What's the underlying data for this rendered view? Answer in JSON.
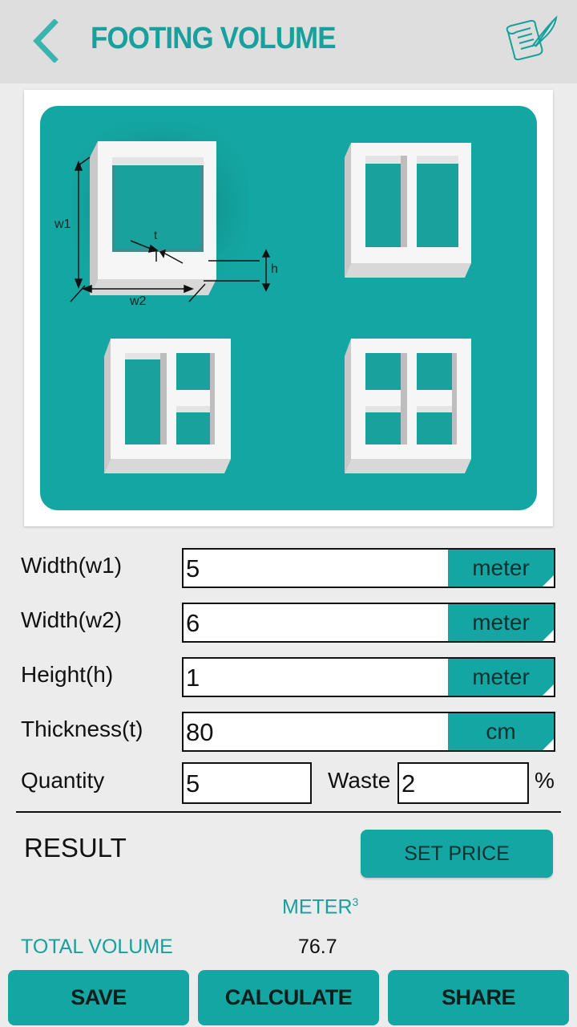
{
  "header": {
    "title": "FOOTING VOLUME",
    "back_icon": "chevron-left-icon",
    "notes_icon": "scroll-quill-icon"
  },
  "diagram": {
    "labels": {
      "w1": "w1",
      "w2": "w2",
      "h": "h",
      "t": "t"
    },
    "variants": [
      "single-cell",
      "two-cell",
      "three-cell",
      "four-cell"
    ]
  },
  "form": {
    "fields": [
      {
        "label": "Width(w1)",
        "value": "5",
        "unit": "meter"
      },
      {
        "label": "Width(w2)",
        "value": "6",
        "unit": "meter"
      },
      {
        "label": "Height(h)",
        "value": "1",
        "unit": "meter"
      },
      {
        "label": "Thickness(t)",
        "value": "80",
        "unit": "cm"
      }
    ],
    "quantity": {
      "label": "Quantity",
      "value": "5"
    },
    "waste": {
      "label": "Waste",
      "value": "2",
      "suffix": "%"
    }
  },
  "result": {
    "label": "RESULT",
    "set_price_label": "SET PRICE",
    "unit_label": "METER",
    "unit_exponent": "3",
    "total_label": "TOTAL VOLUME",
    "total_value": "76.7"
  },
  "actions": {
    "save": "SAVE",
    "calculate": "CALCULATE",
    "share": "SHARE"
  },
  "colors": {
    "accent": "#14a6a2",
    "title_teal": "#17a09c",
    "header_bg": "#dedede",
    "page_bg": "#ececec"
  }
}
